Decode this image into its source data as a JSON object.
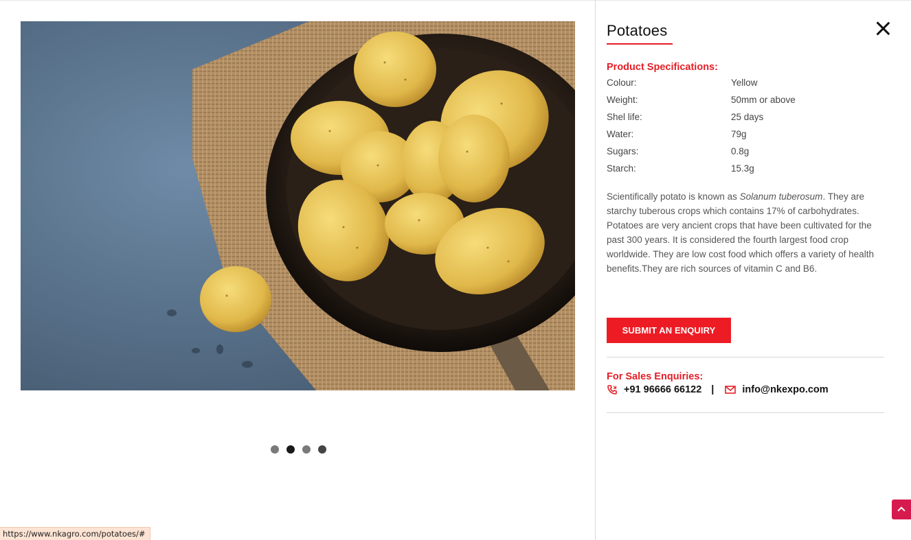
{
  "product": {
    "title": "Potatoes",
    "image_alt": "potatoes in a pan on burlap"
  },
  "gallery": {
    "dots": [
      {
        "state": "inactive"
      },
      {
        "state": "active"
      },
      {
        "state": "inactive"
      },
      {
        "state": "inactive"
      }
    ]
  },
  "specs": {
    "heading": "Product Specifications:",
    "rows": [
      {
        "label": "Colour:",
        "value": "Yellow"
      },
      {
        "label": "Weight:",
        "value": "50mm or above"
      },
      {
        "label": "Shel life:",
        "value": "25 days"
      },
      {
        "label": "Water:",
        "value": "79g"
      },
      {
        "label": "Sugars:",
        "value": "0.8g"
      },
      {
        "label": "Starch:",
        "value": "15.3g"
      }
    ]
  },
  "description": {
    "before": "Scientifically potato is known as ",
    "italic": "Solanum tuberosum",
    "after": ". They are starchy tuberous crops which contains 17% of carbohydrates. Potatoes are very ancient crops that have been cultivated for the past 300 years. It is considered the fourth largest food crop worldwide. They are low cost food which offers a variety of health benefits.They are rich sources of vitamin C and B6."
  },
  "actions": {
    "enquiry_label": "SUBMIT AN ENQUIRY"
  },
  "sales": {
    "heading": "For Sales Enquiries:",
    "phone": "+91 96666 66122",
    "separator": "|",
    "email": "info@nkexpo.com"
  },
  "status_bar": {
    "url": "https://www.nkagro.com/potatoes/#"
  },
  "colors": {
    "accent": "#e41e26",
    "button": "#ed1c24",
    "scroll_top": "#d71a4e"
  },
  "icons": {
    "close": "close-icon",
    "phone": "phone-icon",
    "email": "envelope-icon",
    "scroll_top": "chevron-up-icon"
  }
}
